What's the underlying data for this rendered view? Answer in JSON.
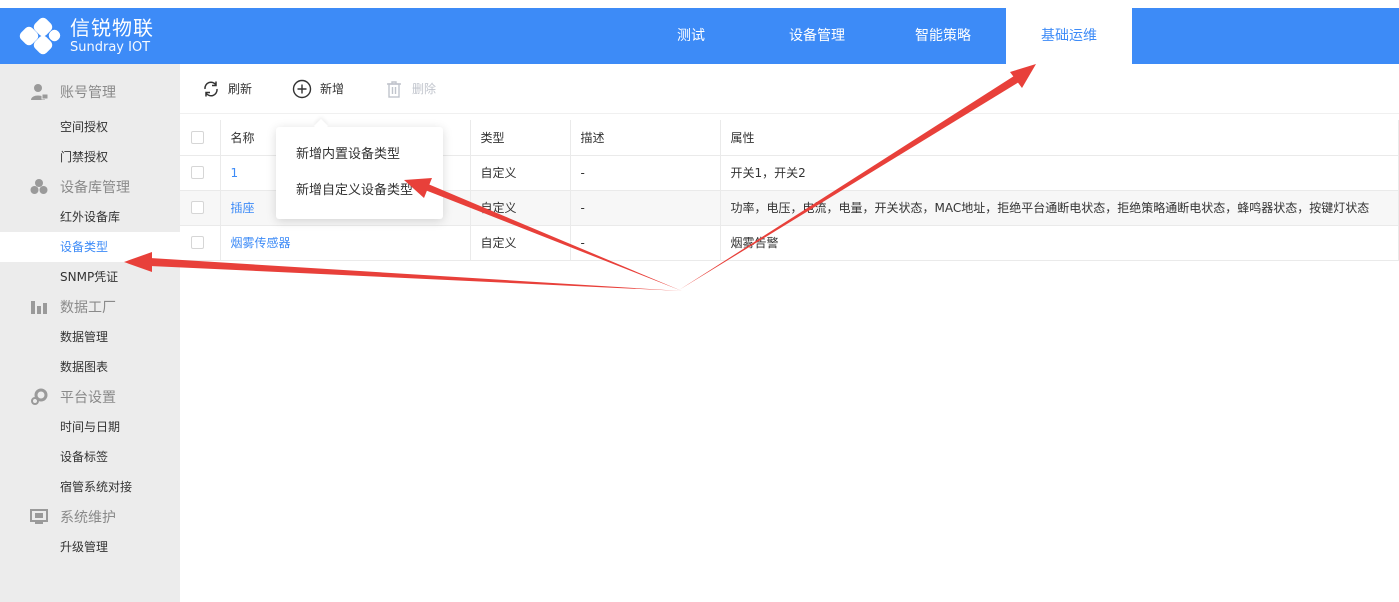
{
  "header": {
    "logo_cn": "信锐物联",
    "logo_en": "Sundray IOT",
    "nav": [
      "测试",
      "设备管理",
      "智能策略",
      "基础运维"
    ],
    "active_nav_index": 3,
    "accent_color": "#3d8bf7"
  },
  "sidebar": {
    "groups": [
      {
        "title": "账号管理",
        "icon": "user-icon",
        "items": [
          "空间授权",
          "门禁授权"
        ]
      },
      {
        "title": "设备库管理",
        "icon": "device-library-icon",
        "items": [
          "红外设备库",
          "设备类型",
          "SNMP凭证"
        ]
      },
      {
        "title": "数据工厂",
        "icon": "data-factory-icon",
        "items": [
          "数据管理",
          "数据图表"
        ]
      },
      {
        "title": "平台设置",
        "icon": "settings-icon",
        "items": [
          "时间与日期",
          "设备标签",
          "宿管系统对接"
        ]
      },
      {
        "title": "系统维护",
        "icon": "monitor-icon",
        "items": [
          "升级管理"
        ]
      }
    ],
    "active_item": "设备类型"
  },
  "toolbar": {
    "refresh_label": "刷新",
    "add_label": "新增",
    "delete_label": "删除"
  },
  "dropdown": {
    "items": [
      "新增内置设备类型",
      "新增自定义设备类型"
    ]
  },
  "table": {
    "columns": [
      "名称",
      "类型",
      "描述",
      "属性"
    ],
    "rows": [
      {
        "name": "1",
        "type": "自定义",
        "desc": "-",
        "attrs": "开关1，开关2"
      },
      {
        "name": "插座",
        "type": "自定义",
        "desc": "-",
        "attrs": "功率，电压，电流，电量，开关状态，MAC地址，拒绝平台通断电状态，拒绝策略通断电状态，蜂鸣器状态，按键灯状态"
      },
      {
        "name": "烟雾传感器",
        "type": "自定义",
        "desc": "-",
        "attrs": "烟雾告警"
      }
    ]
  },
  "annotation": {
    "arrow_color": "#e8403a"
  }
}
